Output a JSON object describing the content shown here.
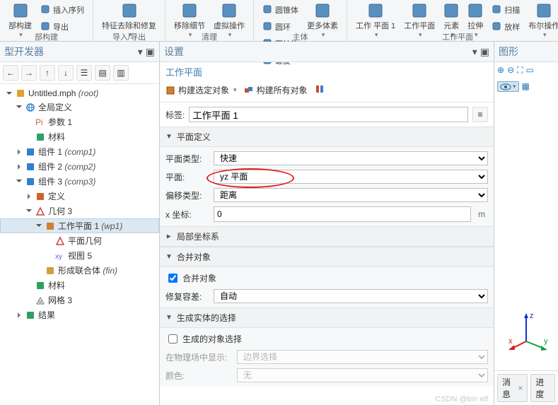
{
  "ribbon": {
    "groups": [
      {
        "title": "部构建",
        "items": [
          {
            "label": "部构建"
          },
          {
            "label": "插入序列",
            "small": true
          },
          {
            "label": "导出",
            "small": true
          }
        ]
      },
      {
        "title": "导入/导出",
        "items": [
          {
            "label": "特征去除和修复"
          }
        ]
      },
      {
        "title": "清理",
        "items": [
          {
            "label": "移除细节"
          },
          {
            "label": "虚拟操作"
          }
        ]
      },
      {
        "title": "主体",
        "items": [
          {
            "label": "圆锥体",
            "small": true
          },
          {
            "label": "圆环",
            "small": true
          },
          {
            "label": "圆柱体",
            "small": true
          },
          {
            "label": "螺旋",
            "small": true
          },
          {
            "label": "更多体素"
          }
        ]
      },
      {
        "title": "工作平面",
        "items": [
          {
            "label": "工作\n平面 1"
          },
          {
            "label": "工作平面"
          },
          {
            "label": "元素"
          },
          {
            "label": "拉伸"
          },
          {
            "label": "扫描",
            "small": true
          },
          {
            "label": "放样",
            "small": true
          },
          {
            "label": "布尔操作"
          }
        ]
      }
    ]
  },
  "tree_panel": {
    "title": "型开发器"
  },
  "tree": [
    {
      "depth": 0,
      "twist": "open",
      "icon": "file",
      "label": "Untitled.mph",
      "suffix": "(root)"
    },
    {
      "depth": 1,
      "twist": "open",
      "icon": "globe",
      "label": "全局定义"
    },
    {
      "depth": 2,
      "twist": null,
      "icon": "pi",
      "label": "参数 1"
    },
    {
      "depth": 2,
      "twist": null,
      "icon": "mat",
      "label": "材料"
    },
    {
      "depth": 1,
      "twist": "closed",
      "icon": "comp",
      "label": "组件 1",
      "suffix": "(comp1)"
    },
    {
      "depth": 1,
      "twist": "closed",
      "icon": "comp",
      "label": "组件 2",
      "suffix": "(comp2)"
    },
    {
      "depth": 1,
      "twist": "open",
      "icon": "comp",
      "label": "组件 3",
      "suffix": "(comp3)"
    },
    {
      "depth": 2,
      "twist": "closed",
      "icon": "def",
      "label": "定义"
    },
    {
      "depth": 2,
      "twist": "open",
      "icon": "geom",
      "label": "几何 3"
    },
    {
      "depth": 3,
      "twist": "open",
      "icon": "wp",
      "label": "工作平面 1",
      "suffix": "(wp1)",
      "selected": true
    },
    {
      "depth": 4,
      "twist": null,
      "icon": "pgeom",
      "label": "平面几何"
    },
    {
      "depth": 4,
      "twist": null,
      "icon": "view",
      "label": "视图 5"
    },
    {
      "depth": 3,
      "twist": null,
      "icon": "union",
      "label": "形成联合体",
      "suffix": "(fin)"
    },
    {
      "depth": 2,
      "twist": null,
      "icon": "mat",
      "label": "材料"
    },
    {
      "depth": 2,
      "twist": null,
      "icon": "mesh",
      "label": "网格 3"
    },
    {
      "depth": 1,
      "twist": "closed",
      "icon": "results",
      "label": "结果"
    }
  ],
  "settings": {
    "title": "设置",
    "subtitle": "工作平面",
    "toolbar": {
      "build_sel": "构建选定对象",
      "build_all": "构建所有对象"
    },
    "tag_label": "标签:",
    "tag_value": "工作平面 1",
    "sections": {
      "plane_def": {
        "title": "平面定义",
        "rows": {
          "plane_type": {
            "label": "平面类型:",
            "value": "快速"
          },
          "plane": {
            "label": "平面:",
            "value": "yz 平面"
          },
          "offset": {
            "label": "偏移类型:",
            "value": "距离"
          },
          "xcoord": {
            "label": "x 坐标:",
            "value": "0",
            "unit": "m"
          }
        }
      },
      "local_cs": {
        "title": "局部坐标系"
      },
      "merge": {
        "title": "合并对象",
        "checkbox": "合并对象",
        "repair_label": "修复容差:",
        "repair_value": "自动"
      },
      "gen_sel": {
        "title": "生成实体的选择",
        "checkbox": "生成的对象选择",
        "show_label": "在物理场中显示:",
        "show_value": "边界选择",
        "color_label": "颜色:",
        "color_value": "无"
      }
    }
  },
  "graphics": {
    "title": "图形",
    "tabs": {
      "t1": "消息",
      "t2": "进度"
    },
    "axes": {
      "x": "x",
      "y": "y",
      "z": "z"
    }
  },
  "watermark": "CSDN @bin elf"
}
